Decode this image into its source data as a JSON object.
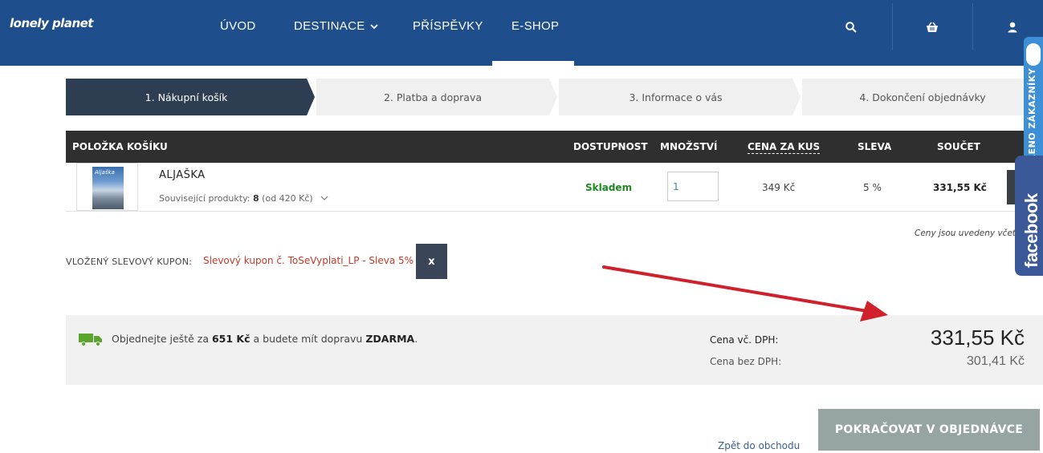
{
  "header": {
    "logo": "lonely planet",
    "nav": [
      "ÚVOD",
      "DESTINACE",
      "PŘÍSPĚVKY",
      "E-SHOP"
    ],
    "icons": [
      "search-icon",
      "basket-icon",
      "user-icon"
    ]
  },
  "steps": [
    "1. Nákupní košík",
    "2. Platba a doprava",
    "3. Informace o vás",
    "4. Dokončení objednávky"
  ],
  "table": {
    "headers": {
      "item": "POLOŽKA KOŠÍKU",
      "availability": "DOSTUPNOST",
      "quantity": "MNOŽSTVÍ",
      "unit_price": "CENA ZA KUS",
      "discount": "SLEVA",
      "total": "SOUČET"
    },
    "row": {
      "cover_title": "Aljaška",
      "name": "ALJAŠKA",
      "related_prefix": "Související produkty:",
      "related_count": "8",
      "related_suffix": "(od 420 Kč)",
      "availability": "Skladem",
      "quantity": "1",
      "unit_price": "349 Kč",
      "discount": "5 %",
      "total": "331,55 Kč"
    },
    "note": "Ceny jsou uvedeny včetně"
  },
  "coupon": {
    "label": "VLOŽENÝ SLEVOVÝ KUPON:",
    "value": "Slevový kupon č. ToSeVyplati_LP - Sleva 5%",
    "remove": "x"
  },
  "summary": {
    "ship_prefix": "Objednejte ještě za",
    "ship_amount": "651 Kč",
    "ship_middle": "a budete mít dopravu",
    "ship_free": "ZDARMA",
    "ship_suffix": ".",
    "label_vat": "Cena vč. DPH:",
    "label_novat": "Cena bez DPH:",
    "total_vat": "331,55 Kč",
    "total_novat": "301,41 Kč"
  },
  "actions": {
    "back": "Zpět do obchodu",
    "continue": "POKRAČOVAT V OBJEDNÁVCE"
  },
  "widgets": {
    "badge": "OVĚŘENO ZÁKAZNÍKY",
    "facebook": "facebook"
  },
  "colors": {
    "header": "#1f4e8c",
    "step_active": "#2e3e52",
    "table_head": "#2f2f2f",
    "stock_green": "#1f8a1f",
    "coupon_red": "#c0392b",
    "continue_btn": "#96a4a4",
    "facebook": "#3b5998",
    "badge": "#3d8fd6",
    "arrow_red": "#d0202a"
  }
}
